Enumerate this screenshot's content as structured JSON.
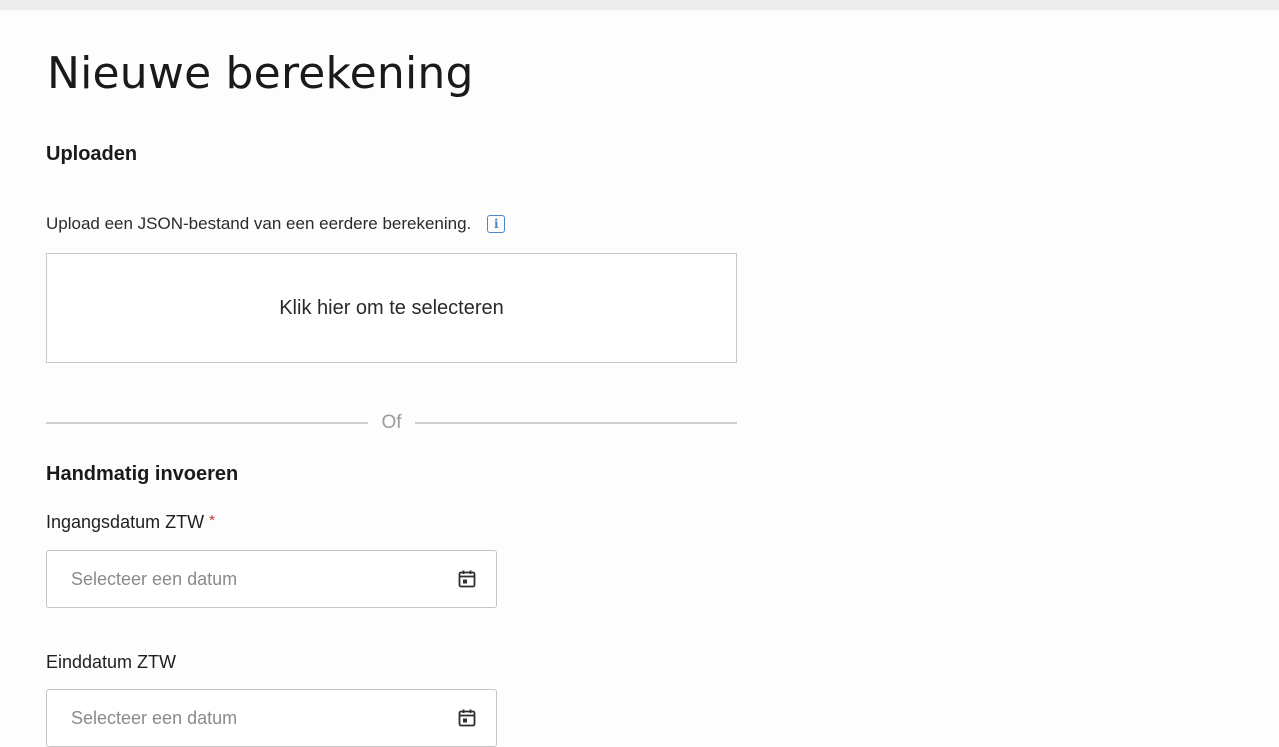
{
  "page": {
    "title": "Nieuwe berekening"
  },
  "upload": {
    "heading": "Uploaden",
    "help_text": "Upload een JSON-bestand van een eerdere berekening.",
    "info_icon": "info-icon",
    "dropzone_label": "Klik hier om te selecteren"
  },
  "divider": {
    "label": "Of"
  },
  "manual": {
    "heading": "Handmatig invoeren",
    "fields": [
      {
        "label": "Ingangsdatum ZTW",
        "required_marker": "*",
        "placeholder": "Selecteer een datum",
        "icon": "calendar-icon"
      },
      {
        "label": "Einddatum ZTW",
        "placeholder": "Selecteer een datum",
        "icon": "calendar-icon"
      }
    ]
  },
  "colors": {
    "accent_info": "#4a86c5",
    "required": "#c0392b",
    "border": "#c4c4c4",
    "placeholder": "#8a8a8a"
  }
}
